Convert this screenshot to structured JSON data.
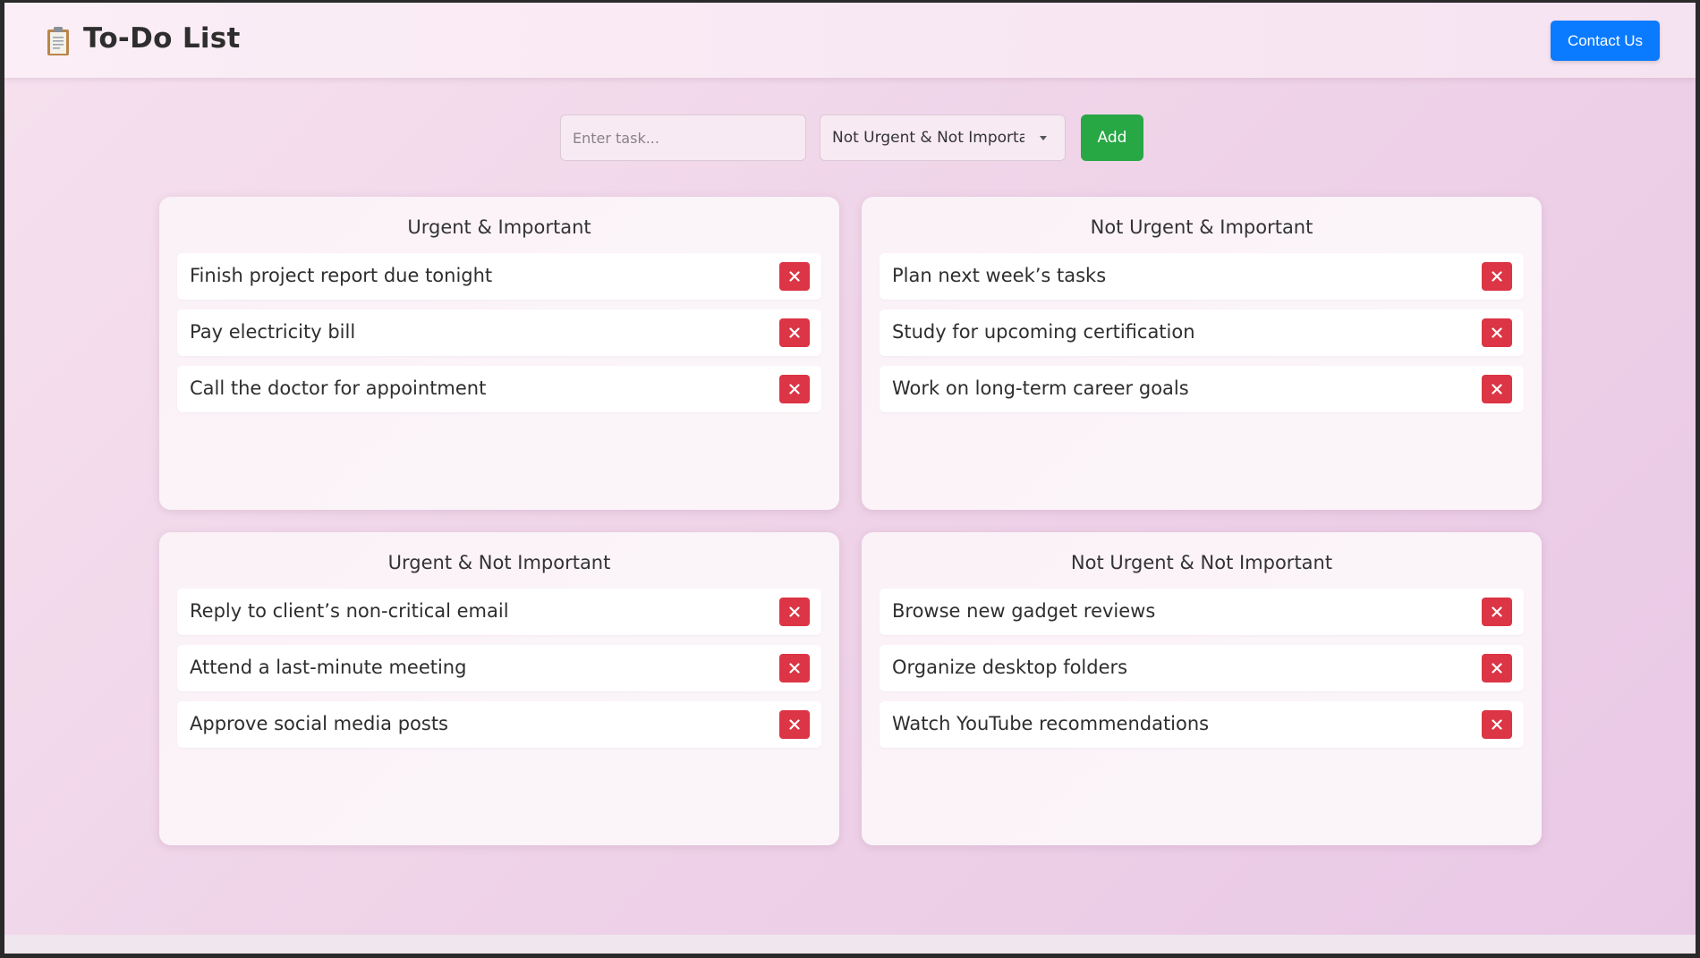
{
  "header": {
    "title": "To-Do List",
    "logo_icon": "clipboard-icon",
    "contact_label": "Contact Us"
  },
  "form": {
    "task_placeholder": "Enter task...",
    "task_value": "",
    "priority_selected": "Not Urgent & Not Important",
    "add_label": "Add"
  },
  "quadrants": [
    {
      "title": "Urgent & Important",
      "tasks": [
        "Finish project report due tonight",
        "Pay electricity bill",
        "Call the doctor for appointment"
      ]
    },
    {
      "title": "Not Urgent & Important",
      "tasks": [
        "Plan next week’s tasks",
        "Study for upcoming certification",
        "Work on long-term career goals"
      ]
    },
    {
      "title": "Urgent & Not Important",
      "tasks": [
        "Reply to client’s non-critical email",
        "Attend a last-minute meeting",
        "Approve social media posts"
      ]
    },
    {
      "title": "Not Urgent & Not Important",
      "tasks": [
        "Browse new gadget reviews",
        "Organize desktop folders",
        "Watch YouTube recommendations"
      ]
    }
  ],
  "colors": {
    "contact_button": "#0a7bff",
    "add_button": "#28a745",
    "delete_button": "#dc3545"
  },
  "icons": {
    "delete": "close-icon",
    "select_caret": "chevron-down-icon"
  }
}
